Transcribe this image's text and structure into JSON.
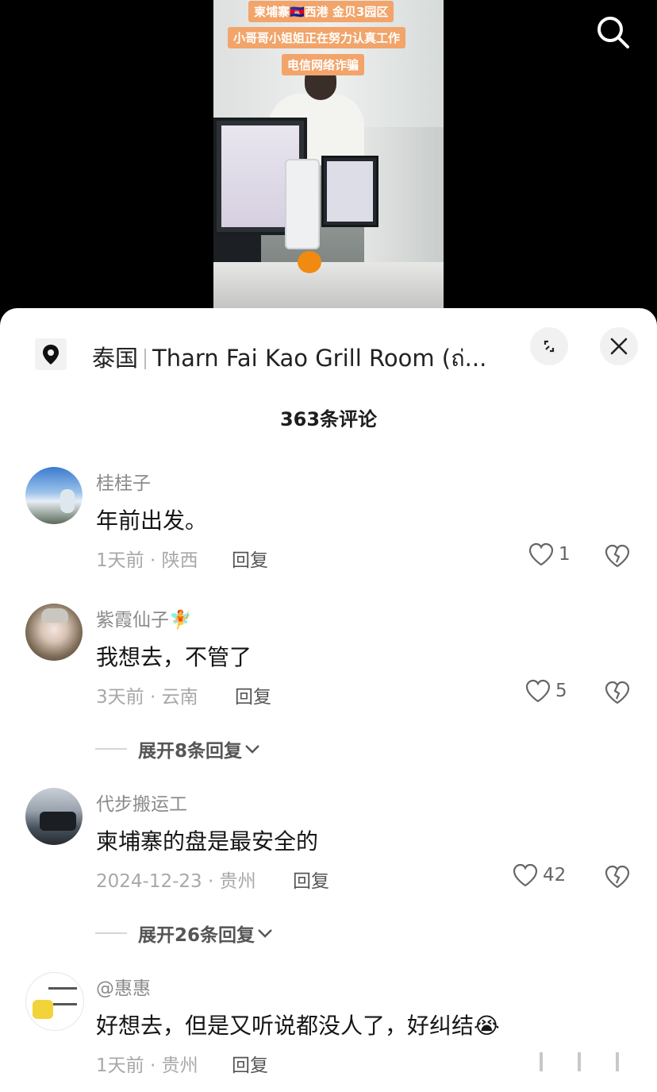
{
  "video": {
    "overlay_lines": [
      "柬埔寨🇰🇭西港 金贝3园区",
      "小哥哥小姐姐正在努力认真工作",
      "电信网络诈骗"
    ]
  },
  "header": {
    "search_icon": "search-icon"
  },
  "location": {
    "country": "泰国",
    "place": "Tharn Fai Kao Grill Room (ถ่..."
  },
  "comments_title": "363条评论",
  "comments": [
    {
      "username": "桂桂子",
      "text": "年前出发。",
      "time": "1天前",
      "region": "陕西",
      "reply_label": "回复",
      "likes": "1"
    },
    {
      "username": "紫霞仙子🧚",
      "text": "我想去，不管了",
      "time": "3天前",
      "region": "云南",
      "reply_label": "回复",
      "likes": "5",
      "expand_label": "展开8条回复"
    },
    {
      "username": "代步搬运工",
      "text": "柬埔寨的盘是最安全的",
      "time": "2024-12-23",
      "region": "贵州",
      "reply_label": "回复",
      "likes": "42",
      "expand_label": "展开26条回复"
    },
    {
      "username": "@惠惠",
      "text": "好想去，但是又听说都没人了，好纠结😭",
      "time": "1天前",
      "region": "贵州",
      "reply_label": "回复"
    }
  ],
  "meta_sep": " · ",
  "colors": {
    "overlay_tag_bg": "#f2a46a",
    "sheet_bg": "#ffffff",
    "text_primary": "#161616",
    "text_secondary": "#a8a8a8"
  }
}
